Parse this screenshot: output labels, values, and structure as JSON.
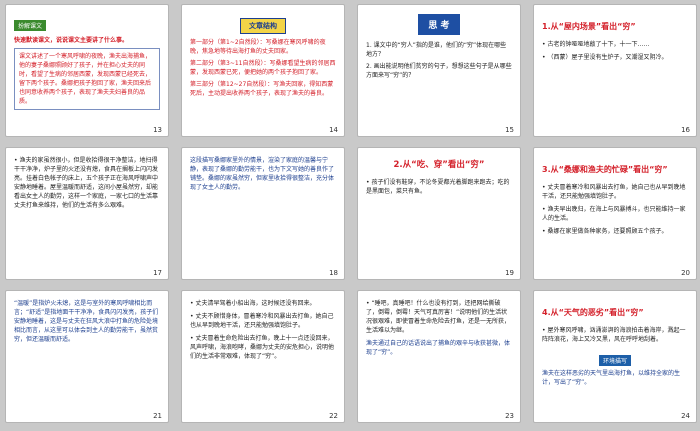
{
  "slides": [
    {
      "num": "13",
      "tag": "扮解课文",
      "title": "快速默读课文，说说课文主要讲了什么事。",
      "text": "课文讲述了一个寒风呼啸的夜晚，渔夫出海捕鱼，他的妻子桑娜照顾好了孩子，并在担心丈夫的同时，看望了生病的邻居西蒙，发现西蒙已经死去，留下两个孩子。桑娜把孩子抱回了家，渔夫回来后也同意收养两个孩子，表现了渔夫夫妇善良的品质。"
    },
    {
      "num": "14",
      "title": "文章结构",
      "sections": [
        "第一部分（第1~2自然段）：写桑娜在寒风呼啸的夜晚，焦急地等待出海打鱼的丈夫回家。",
        "第二部分（第3~11自然段）：写桑娜看望生病的邻居西蒙，发现西蒙已死，便把她的两个孩子抱回了家。",
        "第三部分（第12~27自然段）：写渔夫回家，得知西蒙死后，主动提出收养两个孩子，表现了渔夫的善良。"
      ]
    },
    {
      "num": "15",
      "title": "思  考",
      "questions": [
        "1. 课文中的“穷人”指的是谁，他们的“穷”体现在哪些地方？",
        "2. 画出能说明他们贫穷的句子，想想这些句子是从哪些方面来写“穷”的？"
      ]
    },
    {
      "num": "16",
      "title": "1.从“屋内场景”看出“穷”",
      "bullets": [
        "• 古老的钟哑哑地敲了十下，十一下……",
        "• （西蒙）屋子里没有生炉子，又潮湿又阴冷。"
      ]
    },
    {
      "num": "17",
      "text": "• 渔夫的家虽然很小，但是收拾得很干净整洁，地扫得干干净净，炉子里的火还没有熄，食具在搁板上闪闪发亮。挂着白色帐子的床上，五个孩子正在海风呼啸声中安静地睡着。屋里温暖而舒适，这间小屋虽然穷，却能看出女主人的勤劳，这样一个家庭，一家七口的生活靠丈夫打鱼来维持，他们的生活有多么艰难。"
    },
    {
      "num": "18",
      "text": "这段描写桑娜家里外的情景，渲染了家庭的温馨与宁静，表现了桑娜的勤劳能干，也为下文写她的善良作了铺垫。桑娜的家虽然穷，但家里收拾得很整洁，充分体现了女主人的勤劳。"
    },
    {
      "num": "19",
      "title": "2.从“吃、穿”看出“穷”",
      "bullets": [
        "• 孩子们没有鞋穿，不论冬夏都光着脚跑来跑去；吃的是黑面包，菜只有鱼。"
      ]
    },
    {
      "num": "20",
      "title": "3.从“桑娜和渔夫的忙碌”看出“穷”",
      "bullets": [
        "• 丈夫冒着寒冷和风暴出去打鱼，她自己也从早到晚地干活，还只能勉强填饱肚子。",
        "• 渔夫早出晚归，在海上与风暴搏斗，也只能维持一家人的生活。",
        "• 桑娜在家里做各种家务，还要照顾五个孩子。"
      ]
    },
    {
      "num": "21",
      "text": "“温暖”是指炉火未熄，这是与室外的寒风呼啸相比而言；“舒适”是指地面干干净净，食具闪闪发亮，孩子们安静地睡着，这是与丈夫在狂风大浪中打鱼的危险处境相比而言，从这里可以体会到主人的勤劳能干，虽然贫穷，但还温暖而舒适。"
    },
    {
      "num": "22",
      "bullets": [
        "• 丈夫清早驾着小船出海，这时候还没有回来。",
        "• 丈夫不顾惜身体，冒着寒冷和风暴出去打鱼，她自己也从早到晚地干活，还只能勉强填饱肚子。",
        "• 丈夫冒着生命危险出去打鱼，晚上十一点还没回来，风声呼啸，海浪咆哮，桑娜为丈夫的安危担心，说明他们的生活非常艰难，体现了“穷”。"
      ]
    },
    {
      "num": "23",
      "bullets": [
        "• “睡吧，真睡吧！什么也没有打到，还把网给撕破了，倒霉，倒霉！天气可真厉害！”说明他们的生活状况很艰难，即使冒着生命危险去打鱼，还是一无所获，生活难以为继。"
      ],
      "extra": "渔夫通过自己的话语说出了捕鱼的艰辛与收获甚微，体现了“穷”。"
    },
    {
      "num": "24",
      "title": "4.从“天气的恶劣”看出“穷”",
      "bullets": [
        "• 屋外寒风呼啸，汹涌澎湃的海浪拍击着海岸，溅起一阵阵浪花，海上又冷又黑，风在呼呼地刮着。"
      ],
      "tag": "环境描写",
      "extra": "渔夫在这样恶劣的天气里出海打鱼，以维持全家的生计，写出了“穷”。"
    }
  ]
}
